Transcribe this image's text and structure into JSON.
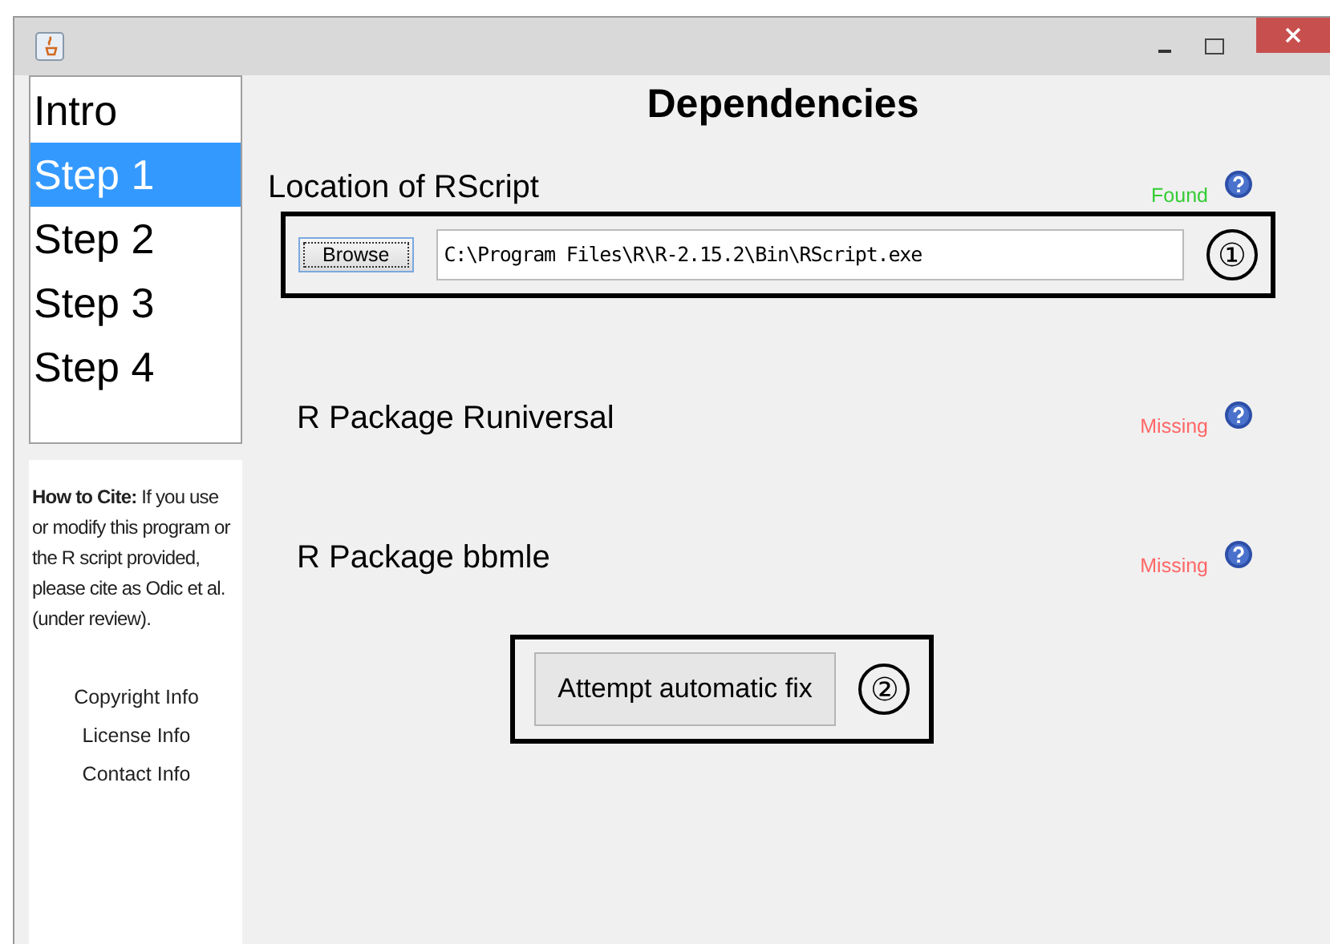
{
  "sidebar": {
    "steps": [
      {
        "label": "Intro",
        "selected": false
      },
      {
        "label": "Step 1",
        "selected": true
      },
      {
        "label": "Step 2",
        "selected": false
      },
      {
        "label": "Step 3",
        "selected": false
      },
      {
        "label": "Step 4",
        "selected": false
      }
    ],
    "cite": "**How to Cite:** If you use or modify this program or the R script provided, please cite as Odic et al. (under review).",
    "links": [
      "Copyright Info",
      "License Info",
      "Contact Info"
    ]
  },
  "main": {
    "title": "Dependencies",
    "dependencies": [
      {
        "label": "Location of RScript",
        "status": "Found",
        "found": true,
        "browse": {
          "button": "Browse",
          "value": "C:\\Program Files\\R\\R-2.15.2\\Bin\\RScript.exe",
          "callout": "①"
        }
      },
      {
        "label": "R Package Runiversal",
        "status": "Missing",
        "found": false
      },
      {
        "label": "R Package bbmle",
        "status": "Missing",
        "found": false
      }
    ],
    "fix": {
      "button": "Attempt automatic fix",
      "callout": "②"
    }
  }
}
